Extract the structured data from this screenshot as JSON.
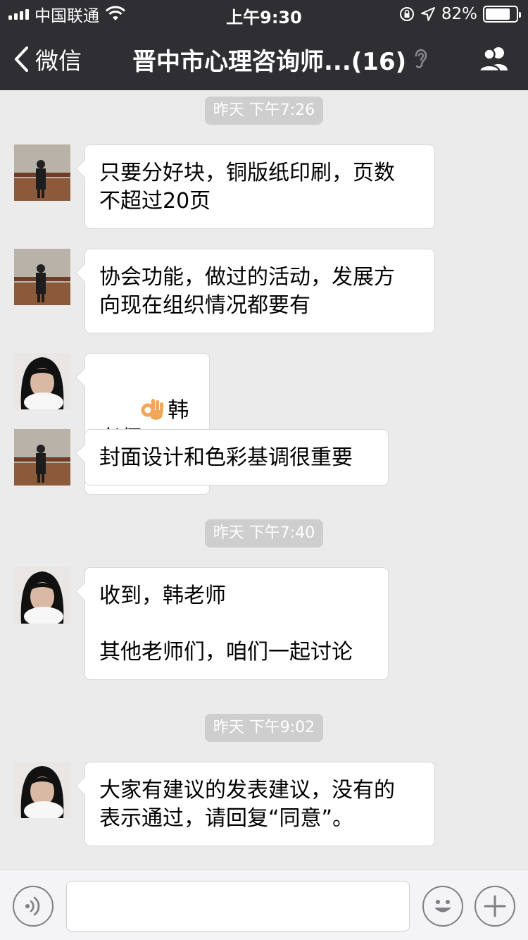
{
  "status_bar": {
    "carrier": "中国联通",
    "time": "上午9:30",
    "battery_pct": "82%",
    "battery_level": 0.82
  },
  "nav": {
    "back_label": "微信",
    "title": "晋中市心理咨询师...(16)"
  },
  "timestamps": [
    "昨天 下午7:26",
    "昨天 下午7:40",
    "昨天 下午9:02"
  ],
  "messages": [
    {
      "avatar": "man-avatar",
      "text": "只要分好块，铜版纸印刷，页数\n不超过20页"
    },
    {
      "avatar": "man-avatar",
      "text": "协会功能，做过的活动，发展方\n向现在组织情况都要有"
    },
    {
      "avatar": "woman-avatar",
      "emoji": "ok-hand-emoji",
      "text": "韩老师"
    },
    {
      "avatar": "man-avatar",
      "text": "封面设计和色彩基调很重要"
    },
    {
      "avatar": "woman-avatar",
      "text": "收到，韩老师\n\n其他老师们，咱们一起讨论"
    },
    {
      "avatar": "woman-avatar",
      "text": "大家有建议的发表建议，没有的\n表示通过，请回复“同意”。"
    }
  ],
  "input": {
    "value": "",
    "placeholder": ""
  },
  "colors": {
    "nav_bg": "#2e2e33",
    "chat_bg": "#ebebeb",
    "bubble_bg": "#ffffff",
    "timestamp_bg": "#cecece"
  }
}
